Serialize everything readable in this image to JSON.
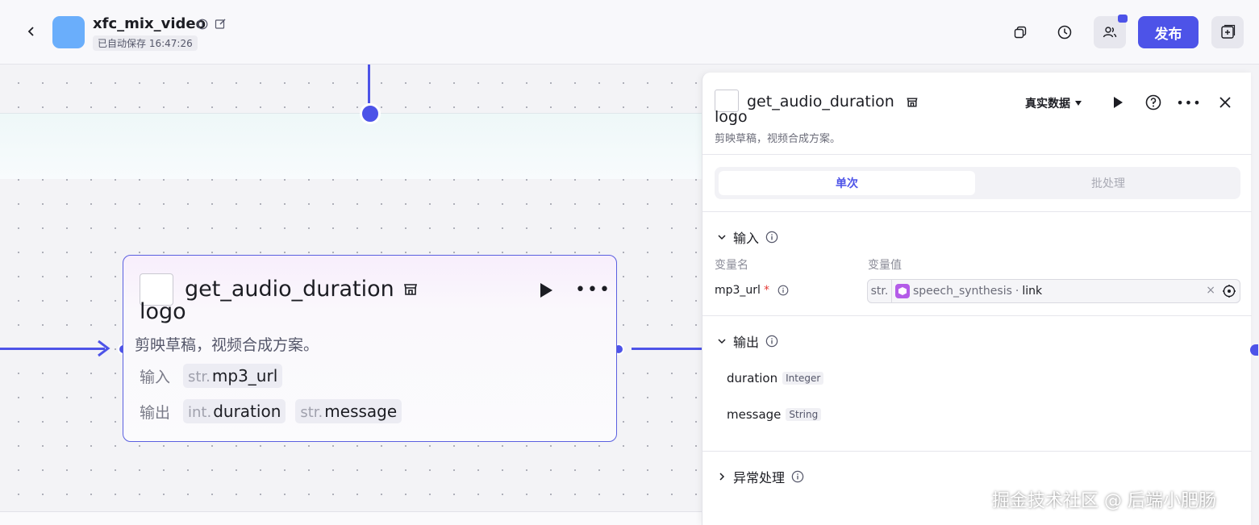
{
  "header": {
    "app_title": "xfc_mix_video",
    "autosave": "已自动保存 16:47:26",
    "publish_label": "发布"
  },
  "node": {
    "logo_alt": "logo",
    "title": "get_audio_duration",
    "description": "剪映草稿，视频合成方案。",
    "input_label": "输入",
    "output_label": "输出",
    "inputs": [
      {
        "type": "str.",
        "name": "mp3_url"
      }
    ],
    "outputs": [
      {
        "type": "int.",
        "name": "duration"
      },
      {
        "type": "str.",
        "name": "message"
      }
    ]
  },
  "panel": {
    "logo_alt": "logo",
    "title": "get_audio_duration",
    "description": "剪映草稿，视频合成方案。",
    "data_select": "真实数据",
    "tabs": [
      {
        "label": "单次",
        "active": true
      },
      {
        "label": "批处理",
        "active": false
      }
    ],
    "input_section": "输入",
    "col_var_name": "变量名",
    "col_var_value": "变量值",
    "input_var": {
      "name": "mp3_url",
      "required_mark": "*",
      "type": "str.",
      "source": "speech_synthesis",
      "sep": "·",
      "key": "link",
      "clear": "×"
    },
    "output_section": "输出",
    "outputs": [
      {
        "name": "duration",
        "type": "Integer"
      },
      {
        "name": "message",
        "type": "String"
      }
    ],
    "error_section": "异常处理"
  },
  "watermark": "掘金技术社区 @ 后端小肥肠",
  "colors": {
    "accent": "#4d53e8",
    "plugin": "#b45ce8",
    "app_icon": "#6aaefb"
  },
  "icons": [
    "back-icon",
    "info-icon",
    "edit-icon",
    "copy-icon",
    "history-icon",
    "users-icon",
    "add-icon",
    "store-icon",
    "play-icon",
    "more-icon",
    "help-icon",
    "close-icon",
    "chevron-down-icon",
    "chevron-right-icon",
    "target-icon"
  ]
}
